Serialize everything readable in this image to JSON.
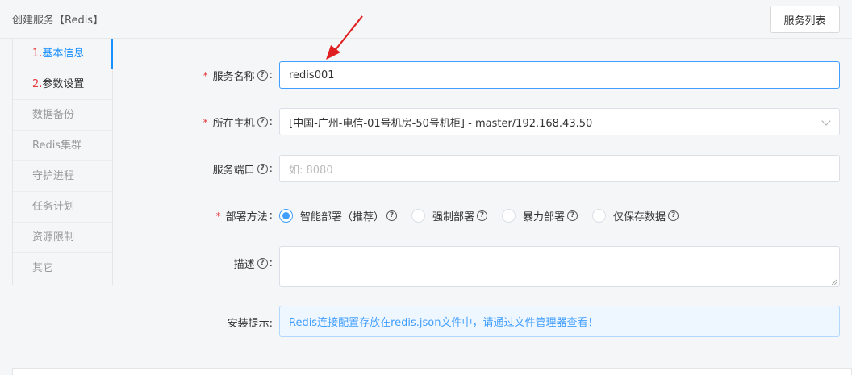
{
  "header": {
    "title": "创建服务【Redis】",
    "list_button": "服务列表"
  },
  "sidebar": {
    "items": [
      {
        "num": "1.",
        "label": "基本信息",
        "state": "active"
      },
      {
        "num": "2.",
        "label": "参数设置",
        "state": "enabled"
      },
      {
        "num": "",
        "label": "数据备份",
        "state": "disabled"
      },
      {
        "num": "",
        "label": "Redis集群",
        "state": "disabled"
      },
      {
        "num": "",
        "label": "守护进程",
        "state": "disabled"
      },
      {
        "num": "",
        "label": "任务计划",
        "state": "disabled"
      },
      {
        "num": "",
        "label": "资源限制",
        "state": "disabled"
      },
      {
        "num": "",
        "label": "其它",
        "state": "disabled"
      }
    ]
  },
  "form": {
    "service_name": {
      "label": "服务名称",
      "value": "redis001",
      "required": true
    },
    "host": {
      "label": "所在主机",
      "value": "[中国-广州-电信-01号机房-50号机柜] - master/192.168.43.50",
      "required": true
    },
    "port": {
      "label": "服务端口",
      "placeholder": "如: 8080"
    },
    "deploy": {
      "label": "部署方法",
      "required": true,
      "options": [
        "智能部署（推荐）",
        "强制部署",
        "暴力部署",
        "仅保存数据"
      ],
      "selected": 0
    },
    "description": {
      "label": "描述"
    },
    "install_hint": {
      "label": "安装提示:",
      "text": "Redis连接配置存放在redis.json文件中，请通过文件管理器查看！"
    }
  },
  "icons": {
    "help": "question-circle-icon",
    "dropdown": "chevron-down-icon",
    "annotation": "red-arrow"
  },
  "colors": {
    "accent": "#409eff",
    "required": "#e4393c",
    "arrow": "#e02020"
  }
}
